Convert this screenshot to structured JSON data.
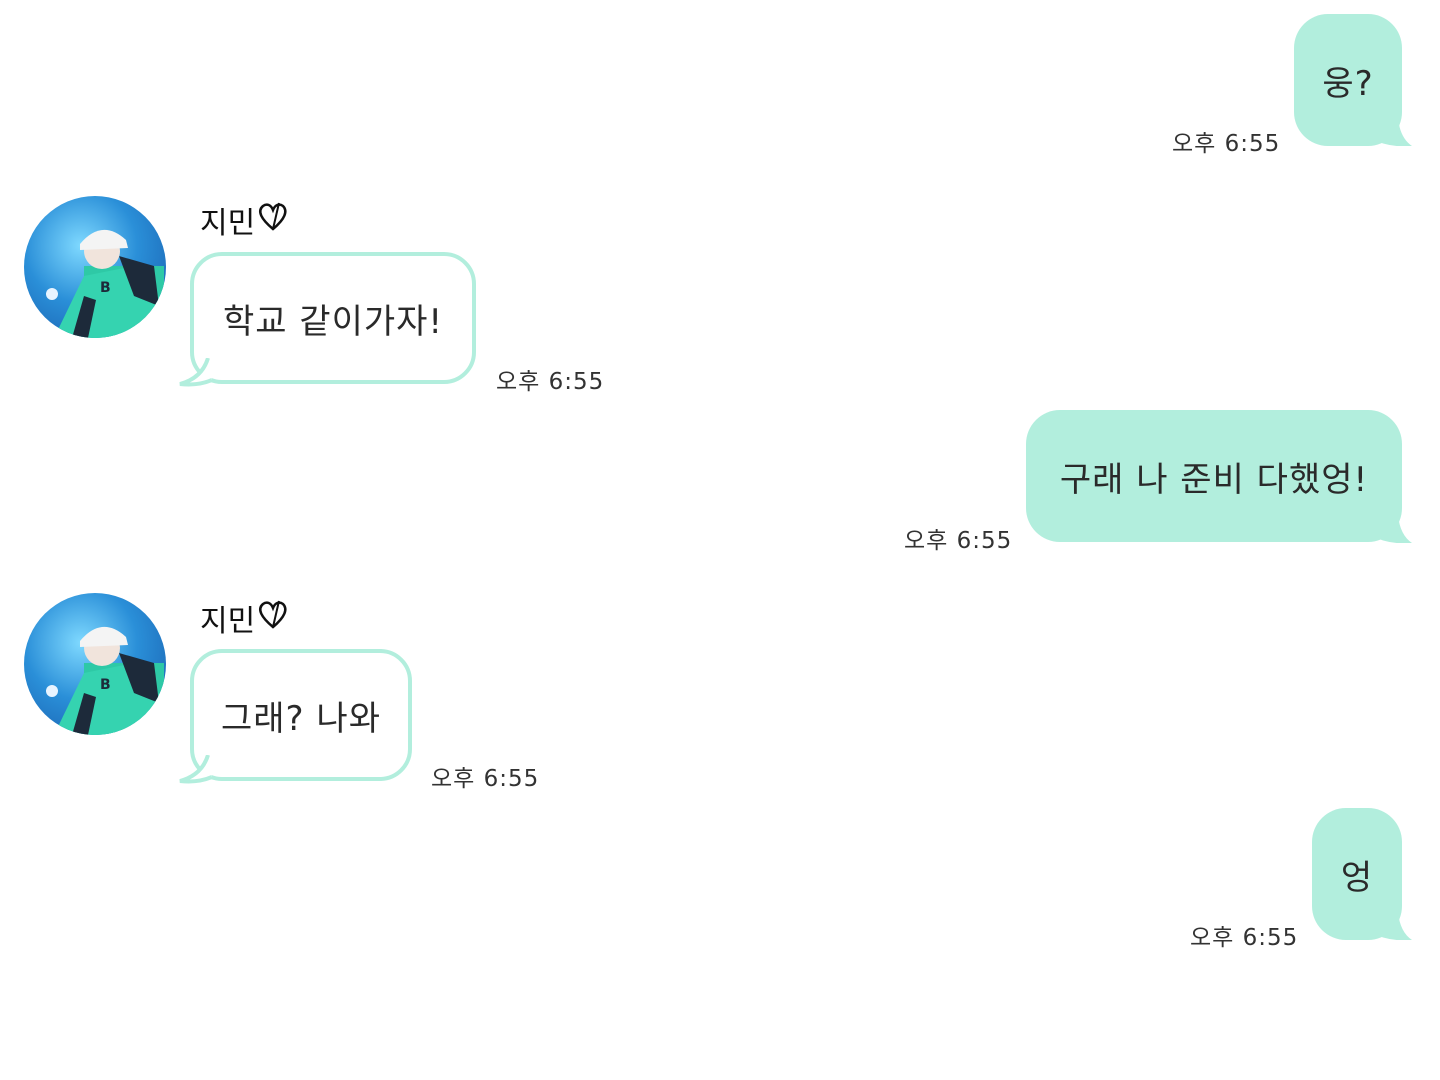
{
  "colors": {
    "outgoing_bubble": "#b2eedd",
    "incoming_border": "#b2eedd",
    "background": "#ffffff"
  },
  "messages": [
    {
      "direction": "out",
      "text": "웅?",
      "time": "오후 6:55"
    },
    {
      "direction": "in",
      "sender": "지민",
      "sender_icon": "heart-icon",
      "text": "학교 같이가자!",
      "time": "오후 6:55"
    },
    {
      "direction": "out",
      "text": "구래 나 준비 다했엉!",
      "time": "오후 6:55"
    },
    {
      "direction": "in",
      "sender": "지민",
      "sender_icon": "heart-icon",
      "text": "그래? 나와",
      "time": "오후 6:55"
    },
    {
      "direction": "out",
      "text": "엉",
      "time": "오후 6:55"
    }
  ]
}
